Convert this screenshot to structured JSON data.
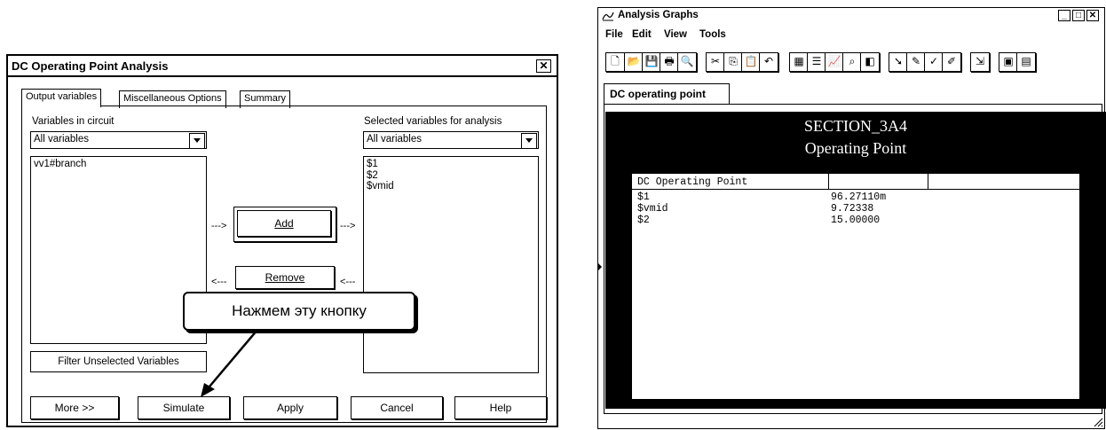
{
  "dialog": {
    "title": "DC Operating Point Analysis",
    "close_glyph": "✕",
    "tabs": [
      {
        "label": "Output variables",
        "active": true
      },
      {
        "label": "Miscellaneous Options",
        "active": false
      },
      {
        "label": "Summary",
        "active": false
      }
    ],
    "left_label": "Variables in circuit",
    "left_filter": "All variables",
    "left_items": [
      "vv1#branch"
    ],
    "right_label": "Selected variables for analysis",
    "right_filter": "All variables",
    "right_items": [
      "$1",
      "$2",
      "$vmid"
    ],
    "add_label": "Add",
    "remove_label": "Remove",
    "arrow_right": "--->",
    "arrow_left": "<---",
    "filter_button": "Filter Unselected Variables",
    "bottom_buttons": [
      "More >>",
      "Simulate",
      "Apply",
      "Cancel",
      "Help"
    ]
  },
  "callout": {
    "text": "Нажмем эту кнопку"
  },
  "graphs": {
    "title": "Analysis Graphs",
    "window_buttons": [
      "_",
      "□",
      "✕"
    ],
    "menu": [
      "File",
      "Edit",
      "View",
      "Tools"
    ],
    "toolbar_icons": [
      "new-icon",
      "open-icon",
      "save-icon",
      "print-icon",
      "print-preview-icon",
      "cut-icon",
      "copy-icon",
      "paste-icon",
      "undo-icon",
      "grid-icon",
      "list-icon",
      "chart-icon",
      "zoom-icon",
      "toggle-icon",
      "cursor-icon",
      "marker-icon",
      "marker2-icon",
      "marker3-icon",
      "export-icon",
      "properties-icon",
      "properties2-icon"
    ],
    "tab_label": "DC operating point",
    "section_title": "SECTION_3A4",
    "section_subtitle": "Operating Point",
    "table_header": "DC Operating Point",
    "rows": [
      {
        "name": "$1",
        "value": "96.27110m"
      },
      {
        "name": "$vmid",
        "value": "9.72338"
      },
      {
        "name": "$2",
        "value": "15.00000"
      }
    ]
  }
}
